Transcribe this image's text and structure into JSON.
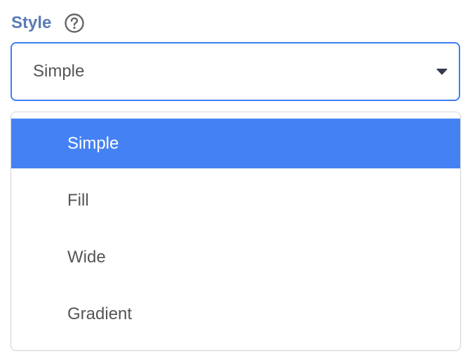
{
  "field": {
    "label": "Style",
    "help_icon": "question-circle-icon"
  },
  "select": {
    "value": "Simple",
    "caret_icon": "caret-down-icon"
  },
  "dropdown": {
    "options": [
      {
        "label": "Simple",
        "selected": true
      },
      {
        "label": "Fill",
        "selected": false
      },
      {
        "label": "Wide",
        "selected": false
      },
      {
        "label": "Gradient",
        "selected": false
      }
    ]
  },
  "colors": {
    "label_text": "#5b7bb5",
    "focus_border": "#3d7ef3",
    "selected_option_bg": "#4482f4",
    "option_text": "#555555"
  }
}
